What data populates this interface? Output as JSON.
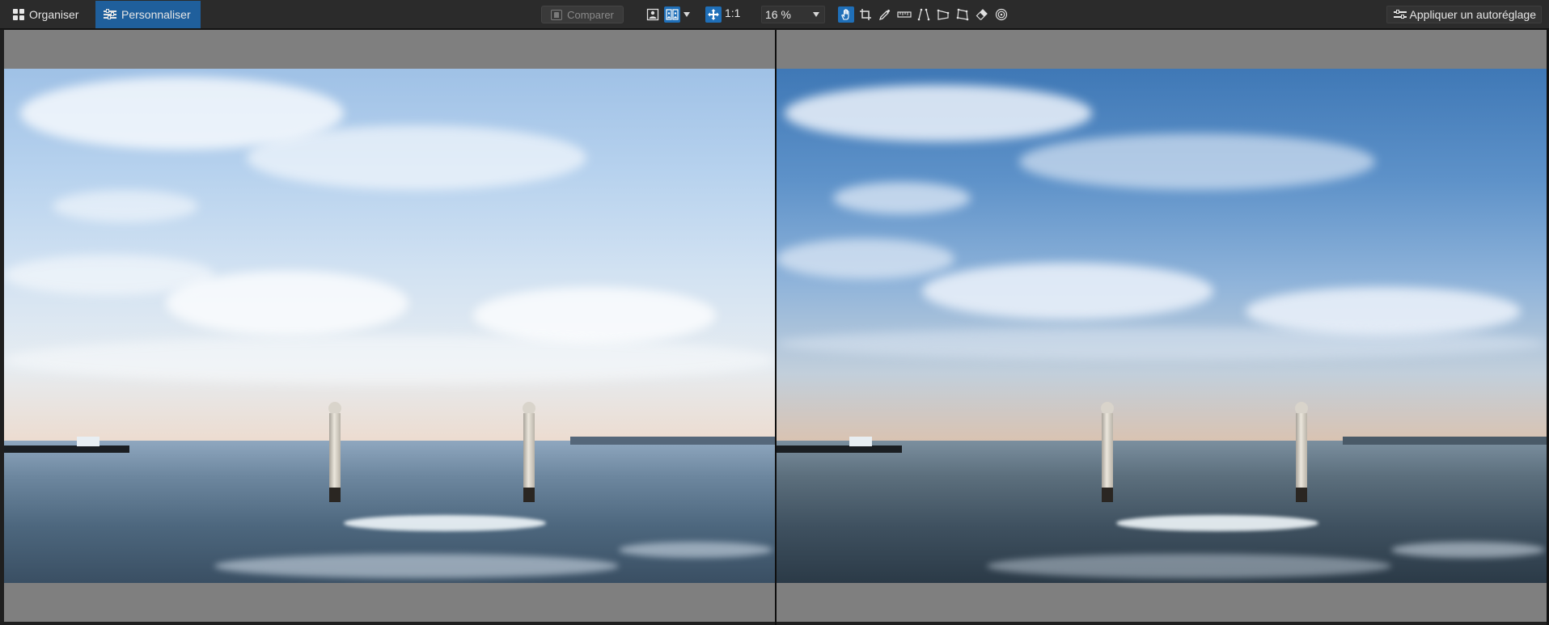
{
  "toolbar": {
    "organize_label": "Organiser",
    "customize_label": "Personnaliser",
    "compare_label": "Comparer",
    "one_to_one_label": "1:1",
    "zoom_value": "16 %",
    "auto_adjust_label": "Appliquer un autoréglage",
    "icons": [
      "grid-icon",
      "sliders-icon",
      "compare-icon",
      "single-view-icon",
      "split-view-icon",
      "chevron-down-icon",
      "move-icon",
      "hand-icon",
      "crop-icon",
      "eyedropper-icon",
      "straighten-icon",
      "perspective-vertical-icon",
      "perspective-horizontal-icon",
      "perspective-rectangle-icon",
      "eraser-icon",
      "target-icon"
    ],
    "active_color": "#1f5f9c"
  },
  "workspace": {
    "left_pane": "original",
    "right_pane": "edited"
  }
}
